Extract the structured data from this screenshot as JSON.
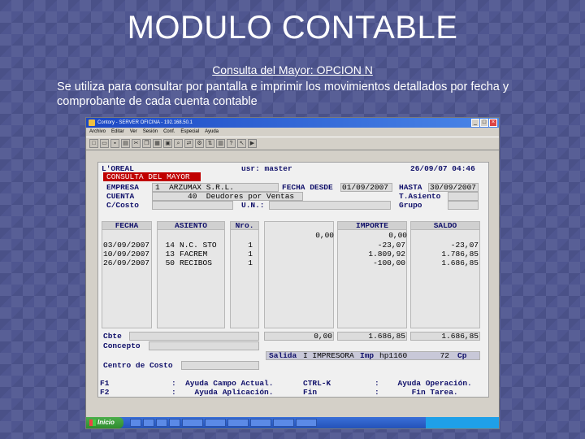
{
  "slide": {
    "title": "MODULO CONTABLE",
    "subtitle": "Consulta del Mayor:  OPCION N",
    "description": "Se utiliza para consultar por pantalla e imprimir los movimientos detallados por fecha y comprobante de cada cuenta contable"
  },
  "window": {
    "title": "Contory - SERVER OFICINA - 192.168.50.1",
    "menu": [
      "Archivo",
      "Editar",
      "Ver",
      "Sesión",
      "Conf.",
      "Especial",
      "Ayuda"
    ],
    "start_label": "Inicio"
  },
  "terminal": {
    "company": "L'OREAL",
    "user": "usr: master",
    "datetime": "26/09/07 04:46",
    "module_label": "CONSULTA DEL MAYOR",
    "empresa_label": "EMPRESA",
    "empresa_value": "1  ARZUMAX S.R.L.",
    "cuenta_label": "CUENTA",
    "cuenta_value": "40  Deudores por Ventas",
    "ccosto_label": "C/Costo",
    "un_label": "U.N.:",
    "fecha_desde_label": "FECHA DESDE",
    "fecha_desde_value": "01/09/2007",
    "hasta_label": "HASTA",
    "hasta_value": "30/09/2007",
    "tasiento_label": "T.Asiento",
    "grupo_label": "Grupo",
    "columns": [
      "FECHA",
      "ASIENTO",
      "Nro.",
      "IMPORTE",
      "SALDO"
    ],
    "opening": {
      "importe": "0,00",
      "saldo": "0,00"
    },
    "rows": [
      {
        "fecha": "03/09/2007",
        "asiento_nro": "14",
        "asiento_tipo": "N.C. STO",
        "nro": "1",
        "importe": "-23,07",
        "saldo": "-23,07"
      },
      {
        "fecha": "10/09/2007",
        "asiento_nro": "13",
        "asiento_tipo": "FACREM",
        "nro": "1",
        "importe": "1.809,92",
        "saldo": "1.786,85"
      },
      {
        "fecha": "26/09/2007",
        "asiento_nro": "50",
        "asiento_tipo": "RECIBOS",
        "nro": "1",
        "importe": "-100,00",
        "saldo": "1.686,85"
      }
    ],
    "cbte_label": "Cbte",
    "concepto_label": "Concepto",
    "totals": {
      "debe": "0,00",
      "haber": "1.686,85",
      "saldo": "1.686,85"
    },
    "salida_label": "Salida",
    "salida_value": "I IMPRESORA",
    "imp_label": "Imp",
    "imp_value": "hp1160",
    "cp_number": "72",
    "cp_label": "Cp",
    "centro_costo_label": "Centro de Costo",
    "help": {
      "f1_key": "F1",
      "f1_text": ":  Ayuda Campo Actual.",
      "f2_key": "F2",
      "f2_text": ":    Ayuda Aplicación.",
      "ctrlk_key": "CTRL-K",
      "ctrlk_text": ":    Ayuda Operación.",
      "fin_key": "Fin",
      "fin_text": ":       Fin Tarea."
    }
  }
}
